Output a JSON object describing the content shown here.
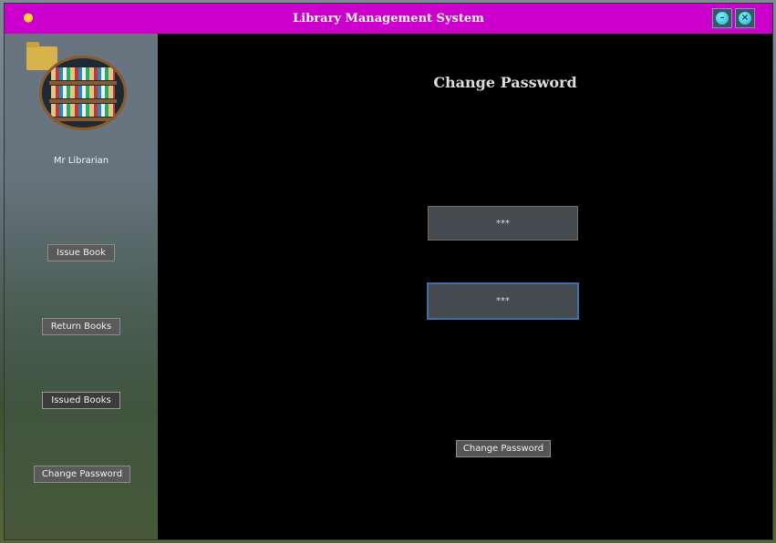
{
  "window": {
    "title": "Library Management System",
    "accent_color": "#cc00cc"
  },
  "titlebar": {
    "app_icon": "bulb-icon",
    "minimize_icon": "minimize-icon",
    "close_icon": "close-icon"
  },
  "sidebar": {
    "librarian_name": "Mr Librarian",
    "buttons": [
      {
        "label": "Issue Book"
      },
      {
        "label": "Return Books"
      },
      {
        "label": "Issued Books"
      },
      {
        "label": "Change Password"
      }
    ]
  },
  "main": {
    "title": "Change Password",
    "fields": [
      {
        "value": "***"
      },
      {
        "value": "***"
      }
    ],
    "submit_label": "Change Password"
  }
}
